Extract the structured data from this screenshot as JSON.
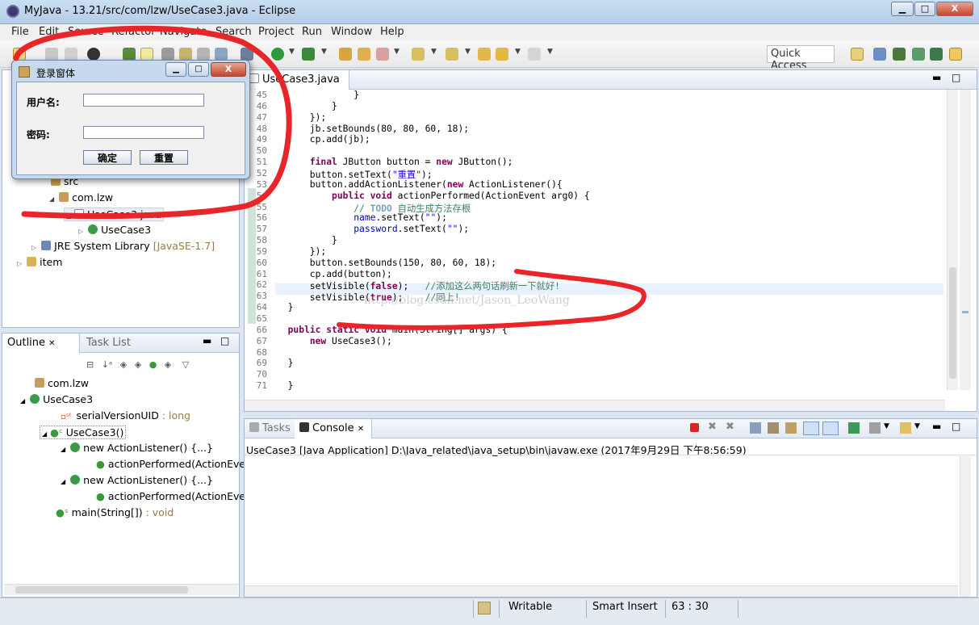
{
  "window": {
    "title": "MyJava - 13.21/src/com/lzw/UseCase3.java - Eclipse",
    "min": "▁",
    "max": "□",
    "close": "X"
  },
  "menu": [
    "File",
    "Edit",
    "Source",
    "Refactor",
    "Navigate",
    "Search",
    "Project",
    "Run",
    "Window",
    "Help"
  ],
  "toolbar": {
    "quick_access": "Quick Access"
  },
  "dialog": {
    "title": "登录窗体",
    "username_label": "用户名:",
    "password_label": "密码:",
    "username_value": "",
    "password_value": "",
    "ok_button": "确定",
    "reset_button": "重置"
  },
  "explorer": {
    "items": [
      {
        "label": "src"
      },
      {
        "label": "com.lzw"
      },
      {
        "label": "UseCase3.java"
      },
      {
        "label": "UseCase3"
      },
      {
        "label": "JRE System Library",
        "extra": "[JavaSE-1.7]"
      },
      {
        "label": "item"
      }
    ]
  },
  "outline": {
    "tab": "Outline",
    "tab2": "Task List",
    "items": [
      {
        "label": "com.lzw"
      },
      {
        "label": "UseCase3"
      },
      {
        "label": "serialVersionUID",
        "type": " : long"
      },
      {
        "label": "UseCase3()"
      },
      {
        "label": "new ActionListener() {...}"
      },
      {
        "label": "actionPerformed(ActionEve"
      },
      {
        "label": "new ActionListener() {...}"
      },
      {
        "label": "actionPerformed(ActionEve"
      },
      {
        "label": "main(String[])",
        "type": " : void"
      }
    ]
  },
  "editor": {
    "tab": "UseCase3.java",
    "line_numbers": [
      "45",
      "46",
      "47",
      "48",
      "49",
      "50",
      "51",
      "52",
      "53",
      "54",
      "55",
      "56",
      "57",
      "58",
      "59",
      "60",
      "61",
      "62",
      "63",
      "64",
      "65",
      "66",
      "67",
      "68",
      "69",
      "70",
      "71"
    ],
    "watermark": "http://blog.csdn.net/Jason_LeoWang"
  },
  "console": {
    "tab1": "Tasks",
    "tab2": "Console",
    "header": "UseCase3 [Java Application] D:\\Java_related\\java_setup\\bin\\javaw.exe (2017年9月29日 下午8:56:59)"
  },
  "status": {
    "writable": "Writable",
    "insert": "Smart Insert",
    "position": "63 : 30"
  },
  "colors": {
    "annotation_red": "#e8262a",
    "keyword": "#7f0055",
    "string": "#2a00ff",
    "comment": "#3f7f5f"
  }
}
